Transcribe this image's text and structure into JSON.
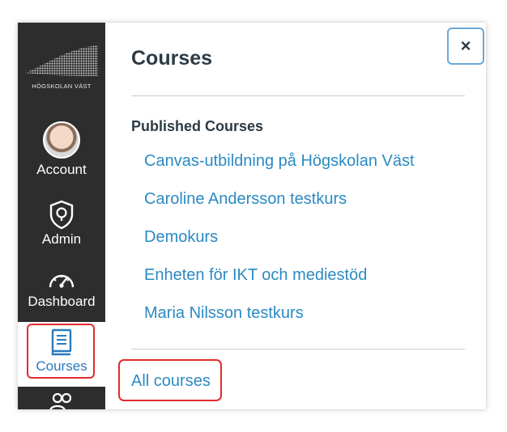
{
  "brand": {
    "logo_text": "HÖGSKOLAN VÄST"
  },
  "global_nav": {
    "account": {
      "label": "Account",
      "icon": "avatar"
    },
    "admin": {
      "label": "Admin",
      "icon": "shield-icon"
    },
    "dashboard": {
      "label": "Dashboard",
      "icon": "speedometer-icon"
    },
    "courses": {
      "label": "Courses",
      "icon": "book-icon"
    },
    "groups": {
      "icon": "people-icon"
    }
  },
  "tray": {
    "title": "Courses",
    "close_label": "×",
    "section_heading": "Published Courses",
    "courses": [
      "Canvas-utbildning på Högskolan Väst",
      "Caroline Andersson testkurs",
      "Demokurs",
      "Enheten för IKT och mediestöd",
      "Maria Nilsson testkurs"
    ],
    "all_courses_label": "All courses"
  },
  "colors": {
    "nav_bg": "#2d2d2d",
    "link": "#2b8ac2",
    "highlight": "#e32b2b",
    "heading": "#2d3b45"
  }
}
